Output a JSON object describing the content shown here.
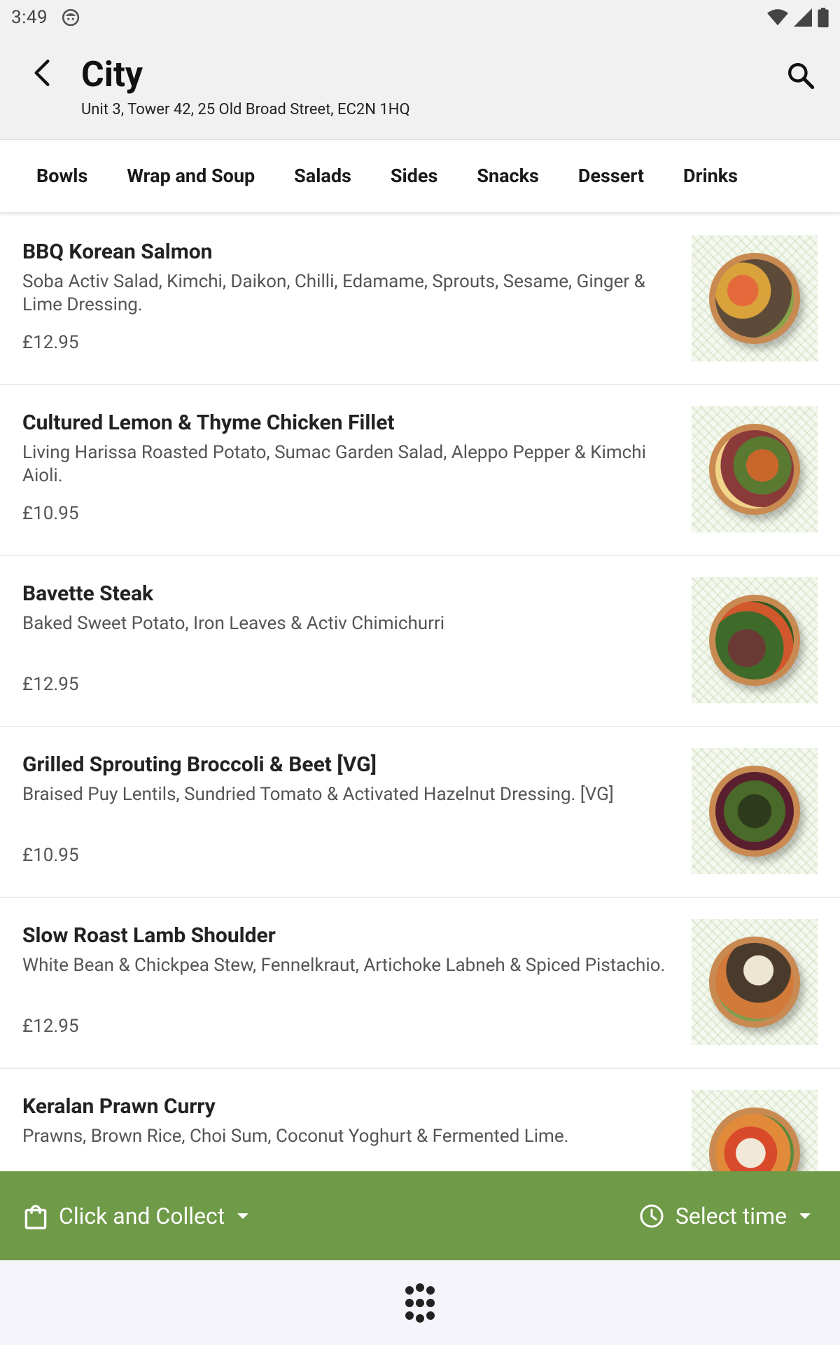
{
  "status_bar": {
    "time": "3:49"
  },
  "header": {
    "title": "City",
    "subtitle": "Unit 3, Tower 42, 25 Old Broad Street, EC2N 1HQ"
  },
  "tabs": [
    {
      "label": "Bowls"
    },
    {
      "label": "Wrap and Soup"
    },
    {
      "label": "Salads"
    },
    {
      "label": "Sides"
    },
    {
      "label": "Snacks"
    },
    {
      "label": "Dessert"
    },
    {
      "label": "Drinks"
    }
  ],
  "menu": {
    "items": [
      {
        "name": "BBQ Korean Salmon",
        "description": "Soba Activ Salad, Kimchi, Daikon, Chilli, Edamame, Sprouts,  Sesame, Ginger & Lime Dressing.",
        "price": "£12.95"
      },
      {
        "name": "Cultured Lemon & Thyme Chicken Fillet",
        "description": "Living Harissa Roasted Potato, Sumac Garden Salad, Aleppo Pepper & Kimchi Aioli.",
        "price": "£10.95"
      },
      {
        "name": "Bavette Steak",
        "description": "Baked Sweet Potato, Iron Leaves & Activ Chimichurri",
        "price": "£12.95"
      },
      {
        "name": "Grilled Sprouting Broccoli & Beet [VG]",
        "description": "Braised Puy Lentils, Sundried Tomato & Activated Hazelnut Dressing. [VG]",
        "price": "£10.95"
      },
      {
        "name": "Slow Roast Lamb Shoulder",
        "description": "White Bean & Chickpea Stew, Fennelkraut, Artichoke Labneh & Spiced Pistachio.",
        "price": "£12.95"
      },
      {
        "name": "Keralan Prawn Curry",
        "description": "Prawns, Brown Rice, Choi Sum, Coconut Yoghurt & Fermented Lime.",
        "price": ""
      }
    ]
  },
  "order_bar": {
    "mode_label": "Click and Collect",
    "time_label": "Select time",
    "color": "#6f9a48"
  }
}
